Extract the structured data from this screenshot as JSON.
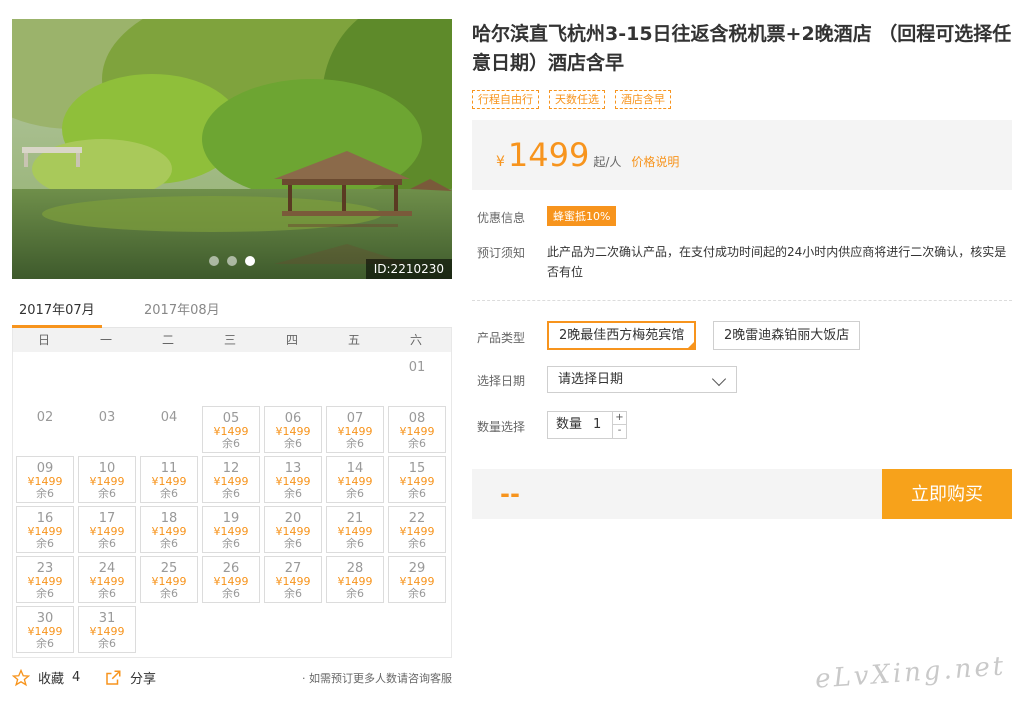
{
  "product": {
    "title": "哈尔滨直飞杭州3-15日往返含税机票+2晚酒店 （回程可选择任意日期）酒店含早",
    "tags": [
      "行程自由行",
      "天数任选",
      "酒店含早"
    ],
    "image_id": "ID:2210230"
  },
  "price": {
    "currency": "¥",
    "amount": "1499",
    "unit": "起/人",
    "explain_link": "价格说明"
  },
  "offers": {
    "label": "优惠信息",
    "coupon": "蜂蜜抵10%"
  },
  "notice": {
    "label": "预订须知",
    "text": "此产品为二次确认产品，在支付成功时间起的24小时内供应商将进行二次确认，核实是否有位"
  },
  "product_type": {
    "label": "产品类型",
    "options": [
      "2晚最佳西方梅苑宾馆",
      "2晚雷迪森铂丽大饭店"
    ],
    "selected": "2晚最佳西方梅苑宾馆"
  },
  "date_select": {
    "label": "选择日期",
    "value": "请选择日期"
  },
  "quantity": {
    "label": "数量选择",
    "field_label": "数量",
    "value": "1",
    "plus": "+",
    "minus": "-"
  },
  "buy": {
    "total": "--",
    "button": "立即购买"
  },
  "calendar": {
    "tabs": [
      "2017年07月",
      "2017年08月"
    ],
    "active_tab": "2017年07月",
    "weekdays": [
      "日",
      "一",
      "二",
      "三",
      "四",
      "五",
      "六"
    ],
    "leading_blanks": 6,
    "price_text": "¥1499",
    "stock_text": "余6",
    "days": [
      {
        "d": "01",
        "avail": false
      },
      {
        "d": "02",
        "avail": false
      },
      {
        "d": "03",
        "avail": false
      },
      {
        "d": "04",
        "avail": false
      },
      {
        "d": "05",
        "avail": true
      },
      {
        "d": "06",
        "avail": true
      },
      {
        "d": "07",
        "avail": true
      },
      {
        "d": "08",
        "avail": true
      },
      {
        "d": "09",
        "avail": true
      },
      {
        "d": "10",
        "avail": true
      },
      {
        "d": "11",
        "avail": true
      },
      {
        "d": "12",
        "avail": true
      },
      {
        "d": "13",
        "avail": true
      },
      {
        "d": "14",
        "avail": true
      },
      {
        "d": "15",
        "avail": true
      },
      {
        "d": "16",
        "avail": true
      },
      {
        "d": "17",
        "avail": true
      },
      {
        "d": "18",
        "avail": true
      },
      {
        "d": "19",
        "avail": true
      },
      {
        "d": "20",
        "avail": true
      },
      {
        "d": "21",
        "avail": true
      },
      {
        "d": "22",
        "avail": true
      },
      {
        "d": "23",
        "avail": true
      },
      {
        "d": "24",
        "avail": true
      },
      {
        "d": "25",
        "avail": true
      },
      {
        "d": "26",
        "avail": true
      },
      {
        "d": "27",
        "avail": true
      },
      {
        "d": "28",
        "avail": true
      },
      {
        "d": "29",
        "avail": true
      },
      {
        "d": "30",
        "avail": true
      },
      {
        "d": "31",
        "avail": true
      }
    ]
  },
  "actions": {
    "favorite_label": "收藏",
    "favorite_count": "4",
    "share_label": "分享",
    "contact_note": "· 如需预订更多人数请咨询客服"
  },
  "watermark": "eLvXing.net",
  "colors": {
    "accent": "#f7941d",
    "panel_bg": "#f4f4f4"
  }
}
